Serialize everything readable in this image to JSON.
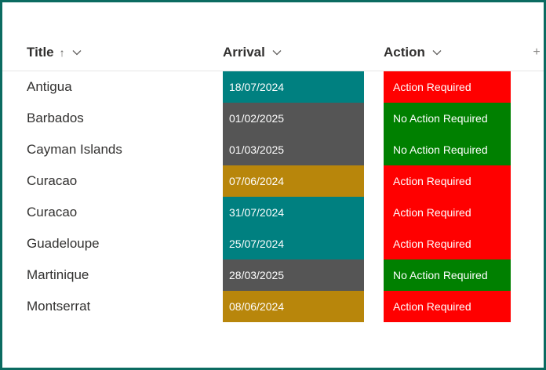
{
  "columns": {
    "title": {
      "label": "Title",
      "sort_glyph": "↑"
    },
    "arrival": {
      "label": "Arrival"
    },
    "action": {
      "label": "Action"
    },
    "add_column": "+"
  },
  "colors": {
    "teal": "#008080",
    "gray": "#555555",
    "gold": "#b8860b",
    "red": "#ff0000",
    "green": "#008000",
    "frame": "#0b6b61"
  },
  "rows": [
    {
      "title": "Antigua",
      "arrival": "18/07/2024",
      "arrival_color": "#008080",
      "action": "Action Required",
      "action_color": "#ff0000"
    },
    {
      "title": "Barbados",
      "arrival": "01/02/2025",
      "arrival_color": "#555555",
      "action": "No Action Required",
      "action_color": "#008000"
    },
    {
      "title": "Cayman Islands",
      "arrival": "01/03/2025",
      "arrival_color": "#555555",
      "action": "No Action Required",
      "action_color": "#008000"
    },
    {
      "title": "Curacao",
      "arrival": "07/06/2024",
      "arrival_color": "#b8860b",
      "action": "Action Required",
      "action_color": "#ff0000"
    },
    {
      "title": "Curacao",
      "arrival": "31/07/2024",
      "arrival_color": "#008080",
      "action": "Action Required",
      "action_color": "#ff0000"
    },
    {
      "title": "Guadeloupe",
      "arrival": "25/07/2024",
      "arrival_color": "#008080",
      "action": "Action Required",
      "action_color": "#ff0000"
    },
    {
      "title": "Martinique",
      "arrival": "28/03/2025",
      "arrival_color": "#555555",
      "action": "No Action Required",
      "action_color": "#008000"
    },
    {
      "title": "Montserrat",
      "arrival": "08/06/2024",
      "arrival_color": "#b8860b",
      "action": "Action Required",
      "action_color": "#ff0000"
    }
  ]
}
